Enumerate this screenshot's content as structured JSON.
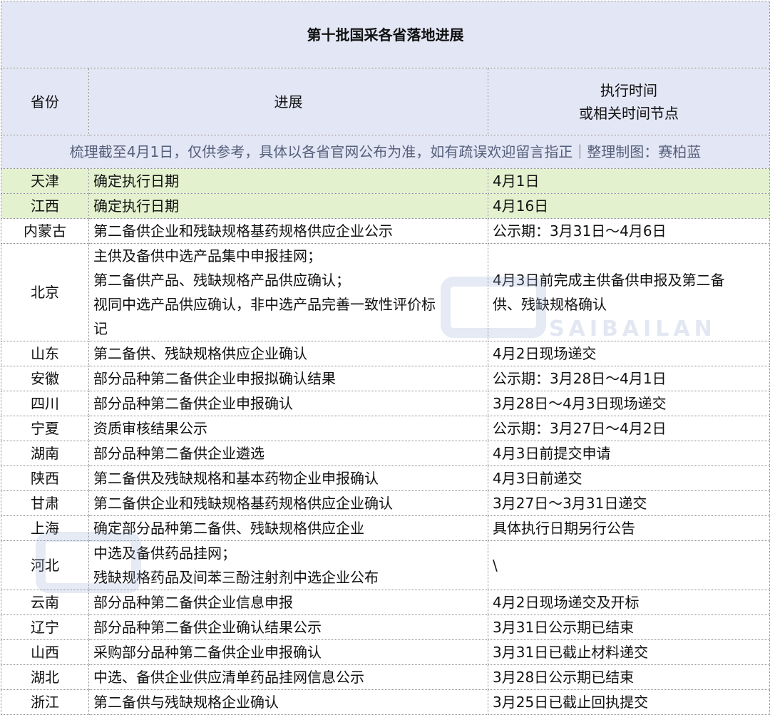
{
  "title": "第十批国采各省落地进展",
  "headers": {
    "province": "省份",
    "progress": "进展",
    "time_line1": "执行时间",
    "time_line2": "或相关时间节点"
  },
  "note": "梳理截至4月1日，仅供参考，具体以各省官网公布为准，如有疏误欢迎留言指正｜整理制图：赛柏蓝",
  "watermark": "SAIBAILAN",
  "rows": [
    {
      "province": "天津",
      "progress": [
        "确定执行日期"
      ],
      "time": [
        "4月1日"
      ]
    },
    {
      "province": "江西",
      "progress": [
        "确定执行日期"
      ],
      "time": [
        "4月16日"
      ]
    },
    {
      "province": "内蒙古",
      "progress": [
        "第二备供企业和残缺规格基药规格供应企业公示"
      ],
      "time": [
        "公示期：3月31日～4月6日"
      ]
    },
    {
      "province": "北京",
      "progress": [
        "主供及备供中选产品集中申报挂网；",
        "第二备供产品、残缺规格产品供应确认；",
        "视同中选产品供应确认，非中选产品完善一致性评价标",
        "记"
      ],
      "time": [
        "4月3日前完成主供备供申报及第二备",
        "供、残缺规格确认"
      ]
    },
    {
      "province": "山东",
      "progress": [
        "第二备供、残缺规格供应企业确认"
      ],
      "time": [
        "4月2日现场递交"
      ]
    },
    {
      "province": "安徽",
      "progress": [
        "部分品种第二备供企业申报拟确认结果"
      ],
      "time": [
        "公示期：3月28日～4月1日"
      ]
    },
    {
      "province": "四川",
      "progress": [
        "部分品种第二备供企业申报确认"
      ],
      "time": [
        "3月28日～4月3日现场递交"
      ]
    },
    {
      "province": "宁夏",
      "progress": [
        "资质审核结果公示"
      ],
      "time": [
        "公示期：3月27日～4月2日"
      ]
    },
    {
      "province": "湖南",
      "progress": [
        "部分品种第二备供企业遴选"
      ],
      "time": [
        "4月3日前提交申请"
      ]
    },
    {
      "province": "陕西",
      "progress": [
        "第二备供及残缺规格和基本药物企业申报确认"
      ],
      "time": [
        "4月3日前递交"
      ]
    },
    {
      "province": "甘肃",
      "progress": [
        "第二备供企业和残缺规格基药规格供应企业确认"
      ],
      "time": [
        "3月27日～3月31日递交"
      ]
    },
    {
      "province": "上海",
      "progress": [
        "确定部分品种第二备供、残缺规格供应企业"
      ],
      "time": [
        "具体执行日期另行公告"
      ]
    },
    {
      "province": "河北",
      "progress": [
        "中选及备供药品挂网；",
        "残缺规格药品及间苯三酚注射剂中选企业公布"
      ],
      "time": [
        "\\"
      ]
    },
    {
      "province": "云南",
      "progress": [
        "部分品种第二备供企业信息申报"
      ],
      "time": [
        "4月2日现场递交及开标"
      ]
    },
    {
      "province": "辽宁",
      "progress": [
        "部分品种第二备供企业确认结果公示"
      ],
      "time": [
        "3月31日公示期已结束"
      ]
    },
    {
      "province": "山西",
      "progress": [
        "采购部分品种第二备供企业申报确认"
      ],
      "time": [
        "3月31日已截止材料递交"
      ]
    },
    {
      "province": "湖北",
      "progress": [
        "中选、备供企业供应清单药品挂网信息公示"
      ],
      "time": [
        "3月28日公示期已结束"
      ]
    },
    {
      "province": "浙江",
      "progress": [
        "第二备供与残缺规格企业确认"
      ],
      "time": [
        "3月25日已截止回执提交"
      ]
    }
  ]
}
